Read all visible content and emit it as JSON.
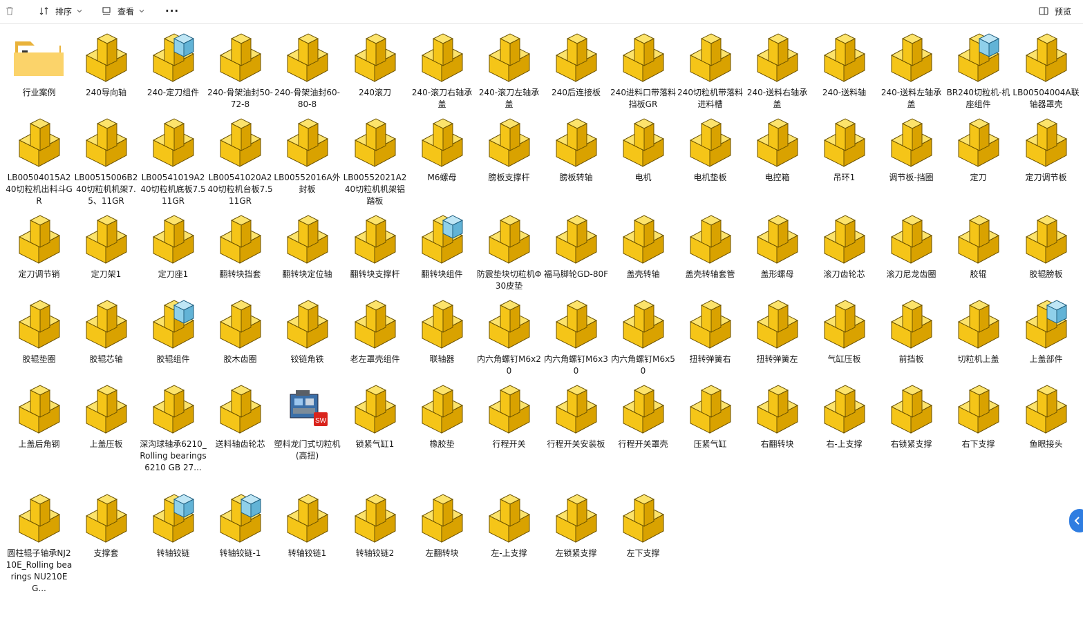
{
  "toolbar": {
    "sort_label": "排序",
    "view_label": "查看",
    "more_label": "···",
    "preview_label": "预览"
  },
  "items": [
    {
      "label": "行业案例",
      "icon": "folder"
    },
    {
      "label": "240导向轴",
      "icon": "part"
    },
    {
      "label": "240-定刀组件",
      "icon": "assembly"
    },
    {
      "label": "240-骨架油封50-72-8",
      "icon": "part"
    },
    {
      "label": "240-骨架油封60-80-8",
      "icon": "part"
    },
    {
      "label": "240滚刀",
      "icon": "part"
    },
    {
      "label": "240-滚刀右轴承盖",
      "icon": "part"
    },
    {
      "label": "240-滚刀左轴承盖",
      "icon": "part"
    },
    {
      "label": "240后连接板",
      "icon": "part"
    },
    {
      "label": "240进料口带落料挡板GR",
      "icon": "part"
    },
    {
      "label": "240切粒机带落料进料槽",
      "icon": "part"
    },
    {
      "label": "240-送料右轴承盖",
      "icon": "part"
    },
    {
      "label": "240-送料轴",
      "icon": "part"
    },
    {
      "label": "240-送料左轴承盖",
      "icon": "part"
    },
    {
      "label": "BR240切粒机-机座组件",
      "icon": "assembly"
    },
    {
      "label": "LB00504004A联轴器罩壳",
      "icon": "part"
    },
    {
      "label": "LB00504015A240切粒机出料斗GR",
      "icon": "part"
    },
    {
      "label": "LB00515006B240切粒机机架7.5、11GR",
      "icon": "part"
    },
    {
      "label": "LB00541019A240切粒机底板7.511GR",
      "icon": "part"
    },
    {
      "label": "LB00541020A240切粒机台板7.511GR",
      "icon": "part"
    },
    {
      "label": "LB00552016A外封板",
      "icon": "part"
    },
    {
      "label": "LB00552021A240切粒机机架铝踏板",
      "icon": "part"
    },
    {
      "label": "M6螺母",
      "icon": "part"
    },
    {
      "label": "膀板支撑杆",
      "icon": "part"
    },
    {
      "label": "膀板转轴",
      "icon": "part"
    },
    {
      "label": "电机",
      "icon": "part"
    },
    {
      "label": "电机垫板",
      "icon": "part"
    },
    {
      "label": "电控箱",
      "icon": "part"
    },
    {
      "label": "吊环1",
      "icon": "part"
    },
    {
      "label": "调节板-挡圈",
      "icon": "part"
    },
    {
      "label": "定刀",
      "icon": "part"
    },
    {
      "label": "定刀调节板",
      "icon": "part"
    },
    {
      "label": "定刀调节销",
      "icon": "part"
    },
    {
      "label": "定刀架1",
      "icon": "part"
    },
    {
      "label": "定刀座1",
      "icon": "part"
    },
    {
      "label": "翻转块挡套",
      "icon": "part"
    },
    {
      "label": "翻转块定位轴",
      "icon": "part"
    },
    {
      "label": "翻转块支撑杆",
      "icon": "part"
    },
    {
      "label": "翻转块组件",
      "icon": "assembly"
    },
    {
      "label": "防震垫块切粒机Φ30皮垫",
      "icon": "part"
    },
    {
      "label": "福马脚轮GD-80F",
      "icon": "part"
    },
    {
      "label": "盖壳转轴",
      "icon": "part"
    },
    {
      "label": "盖壳转轴套管",
      "icon": "part"
    },
    {
      "label": "盖形螺母",
      "icon": "part"
    },
    {
      "label": "滚刀齿轮芯",
      "icon": "part"
    },
    {
      "label": "滚刀尼龙齿圈",
      "icon": "part"
    },
    {
      "label": "胶辊",
      "icon": "part"
    },
    {
      "label": "胶辊膀板",
      "icon": "part"
    },
    {
      "label": "胶辊垫圈",
      "icon": "part"
    },
    {
      "label": "胶辊芯轴",
      "icon": "part"
    },
    {
      "label": "胶辊组件",
      "icon": "assembly"
    },
    {
      "label": "胶木齿圈",
      "icon": "part"
    },
    {
      "label": "铰链角铁",
      "icon": "part"
    },
    {
      "label": "老左罩壳组件",
      "icon": "part"
    },
    {
      "label": "联轴器",
      "icon": "part"
    },
    {
      "label": "内六角螺钉M6x20",
      "icon": "part"
    },
    {
      "label": "内六角螺钉M6x30",
      "icon": "part"
    },
    {
      "label": "内六角螺钉M6x50",
      "icon": "part"
    },
    {
      "label": "扭转弹簧右",
      "icon": "part"
    },
    {
      "label": "扭转弹簧左",
      "icon": "part"
    },
    {
      "label": "气缸压板",
      "icon": "part"
    },
    {
      "label": "前挡板",
      "icon": "part"
    },
    {
      "label": "切粒机上盖",
      "icon": "part"
    },
    {
      "label": "上盖部件",
      "icon": "assembly"
    },
    {
      "label": "上盖后角钢",
      "icon": "part"
    },
    {
      "label": "上盖压板",
      "icon": "part"
    },
    {
      "label": "深沟球轴承6210_Rolling bearings 6210 GB 27...",
      "icon": "part"
    },
    {
      "label": "送料轴齿轮芯",
      "icon": "part"
    },
    {
      "label": "塑料龙门式切粒机(高扭)",
      "icon": "sw-doc"
    },
    {
      "label": "锁紧气缸1",
      "icon": "part"
    },
    {
      "label": "橡胶垫",
      "icon": "part"
    },
    {
      "label": "行程开关",
      "icon": "part"
    },
    {
      "label": "行程开关安装板",
      "icon": "part"
    },
    {
      "label": "行程开关罩壳",
      "icon": "part"
    },
    {
      "label": "压紧气缸",
      "icon": "part"
    },
    {
      "label": "右翻转块",
      "icon": "part"
    },
    {
      "label": "右-上支撑",
      "icon": "part"
    },
    {
      "label": "右锁紧支撑",
      "icon": "part"
    },
    {
      "label": "右下支撑",
      "icon": "part"
    },
    {
      "label": "鱼眼接头",
      "icon": "part"
    },
    {
      "label": "圆柱辊子轴承NJ210E_Rolling bearings NU210E G...",
      "icon": "part"
    },
    {
      "label": "支撑套",
      "icon": "part"
    },
    {
      "label": "转轴铰链",
      "icon": "assembly"
    },
    {
      "label": "转轴铰链-1",
      "icon": "assembly"
    },
    {
      "label": "转轴铰链1",
      "icon": "part"
    },
    {
      "label": "转轴铰链2",
      "icon": "part"
    },
    {
      "label": "左翻转块",
      "icon": "part"
    },
    {
      "label": "左-上支撑",
      "icon": "part"
    },
    {
      "label": "左锁紧支撑",
      "icon": "part"
    },
    {
      "label": "左下支撑",
      "icon": "part"
    }
  ],
  "colors": {
    "part_top": "#fce36b",
    "part_front": "#f5c518",
    "part_side": "#d9a200",
    "assembly_blue": "#8fd0ea",
    "accent": "#2f7de1"
  }
}
